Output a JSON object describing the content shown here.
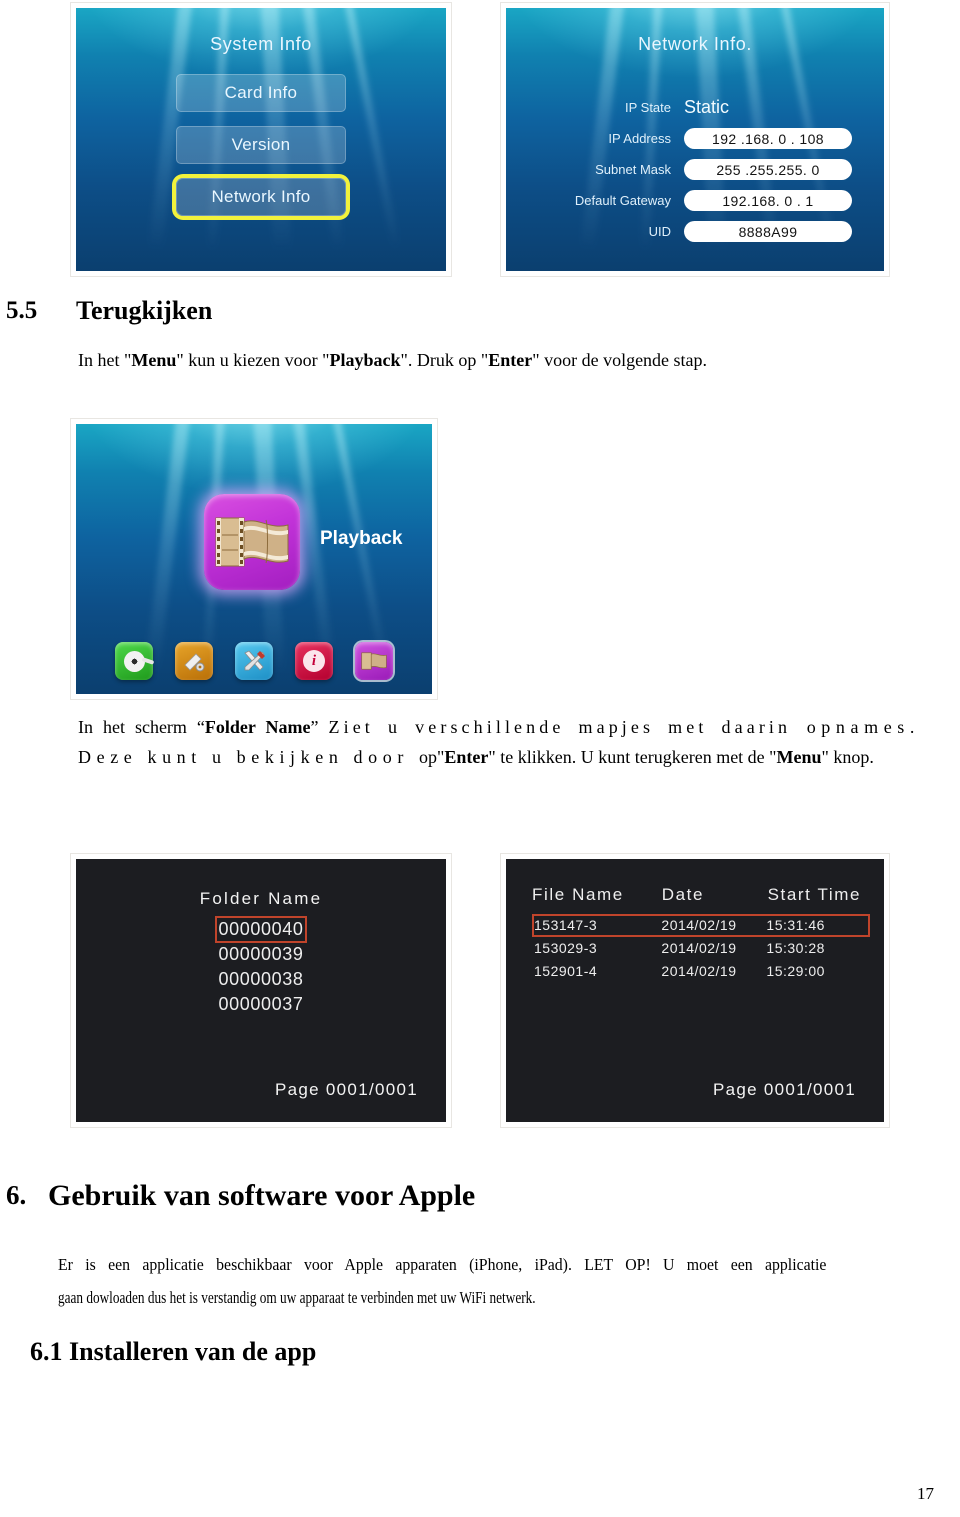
{
  "page": {
    "number": "17"
  },
  "system_info_screen": {
    "title": "System Info",
    "menu_items": [
      {
        "label": "Card Info",
        "selected": false
      },
      {
        "label": "Version",
        "selected": false
      },
      {
        "label": "Network Info",
        "selected": true
      }
    ],
    "highlight_color": "#f2f23c"
  },
  "network_info_screen": {
    "title": "Network Info.",
    "rows": [
      {
        "label": "IP State",
        "value": "Static",
        "style": "plain"
      },
      {
        "label": "IP Address",
        "value": "192 .168.  0 . 108",
        "style": "pill"
      },
      {
        "label": "Subnet Mask",
        "value": "255 .255.255. 0",
        "style": "pill"
      },
      {
        "label": "Default Gateway",
        "value": "192.168.  0 .  1",
        "style": "pill"
      },
      {
        "label": "UID",
        "value": "8888A99",
        "style": "pill"
      }
    ]
  },
  "section_55": {
    "number": "5.5",
    "title": "Terugkijken",
    "paragraph_parts": [
      {
        "text": "In  het  \"",
        "bold": false
      },
      {
        "text": "Menu",
        "bold": true
      },
      {
        "text": "\" kun u kiezen voor \"",
        "bold": false
      },
      {
        "text": "Playback",
        "bold": true
      },
      {
        "text": "\". Druk op \"",
        "bold": false
      },
      {
        "text": "Enter",
        "bold": true
      },
      {
        "text": "\" voor de volgende stap.",
        "bold": false
      }
    ]
  },
  "playback_screen": {
    "selected_app_label": "Playback",
    "selected_app_icon": "film-strip-icon",
    "tray_icons": [
      {
        "name": "film-reel-icon",
        "color": "#2fae2b"
      },
      {
        "name": "recording-settings-icon",
        "color": "#cf8b18"
      },
      {
        "name": "tools-icon",
        "color": "#36a9d8"
      },
      {
        "name": "info-icon",
        "color": "#cf0f45"
      },
      {
        "name": "playback-icon",
        "color": "#b734cf"
      }
    ]
  },
  "folder_paragraph": {
    "parts": [
      {
        "text": "In het scherm “",
        "bold": false,
        "stretch": 0
      },
      {
        "text": "Folder Name",
        "bold": true,
        "stretch": 0
      },
      {
        "text": "” ",
        "bold": false,
        "stretch": 0
      },
      {
        "text": "Ziet u verschillende mapjes met daarin",
        "bold": false,
        "stretch": 1
      },
      {
        "text": " opnames. Deze kunt u bekijken door ",
        "bold": false,
        "stretch": 2
      },
      {
        "text": "op\"",
        "bold": false,
        "stretch": 0
      },
      {
        "text": "Enter",
        "bold": true,
        "stretch": 0
      },
      {
        "text": "\" te klikken. U kunt terugkeren met de \"",
        "bold": false,
        "stretch": 0
      },
      {
        "text": "Menu",
        "bold": true,
        "stretch": 0
      },
      {
        "text": "\" knop.",
        "bold": false,
        "stretch": 0
      }
    ]
  },
  "folder_name_screen": {
    "title": "Folder  Name",
    "folders": [
      {
        "name": "00000040",
        "selected": true
      },
      {
        "name": "00000039",
        "selected": false
      },
      {
        "name": "00000038",
        "selected": false
      },
      {
        "name": "00000037",
        "selected": false
      }
    ],
    "page_indicator": "Page  0001/0001",
    "selection_color": "#c0442b"
  },
  "file_name_screen": {
    "columns": [
      "File  Name",
      "Date",
      "Start  Time"
    ],
    "rows": [
      {
        "file_name": "153147-3",
        "date": "2014/02/19",
        "start_time": "15:31:46",
        "selected": true
      },
      {
        "file_name": "153029-3",
        "date": "2014/02/19",
        "start_time": "15:30:28",
        "selected": false
      },
      {
        "file_name": "152901-4",
        "date": "2014/02/19",
        "start_time": "15:29:00",
        "selected": false
      }
    ],
    "page_indicator": "Page  0001/0001",
    "selection_color": "#c0442b"
  },
  "section_6": {
    "number": "6.",
    "title": "Gebruik van software voor Apple",
    "paragraph_line1": "Er  is  een  applicatie  beschikbaar  voor  Apple  apparaten  (iPhone,  iPad).  LET  OP!  U moet  een  applicatie",
    "paragraph_line2": "gaan dowloaden dus het is verstandig om uw apparaat te verbinden met uw WiFi netwerk."
  },
  "section_61": {
    "title": "6.1 Installeren van de app"
  }
}
